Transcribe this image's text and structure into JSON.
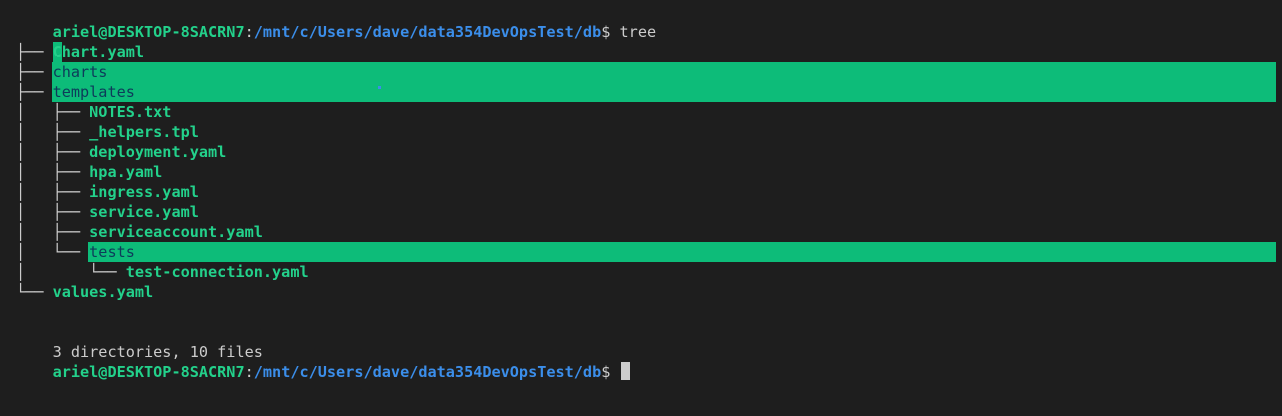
{
  "prompt": {
    "user_host": "ariel@DESKTOP-8SACRN7",
    "separator": ":",
    "path": "/mnt/c/Users/dave/data354DevOpsTest/db",
    "symbol": "$"
  },
  "command": " tree",
  "tree": {
    "root": ".",
    "entries": [
      {
        "branch": "├── ",
        "name": "Chart.yaml",
        "type": "file"
      },
      {
        "branch": "├── ",
        "name": "charts",
        "type": "dir"
      },
      {
        "branch": "├── ",
        "name": "templates",
        "type": "dir"
      },
      {
        "branch": "│   ├── ",
        "name": "NOTES.txt",
        "type": "file"
      },
      {
        "branch": "│   ├── ",
        "name": "_helpers.tpl",
        "type": "file"
      },
      {
        "branch": "│   ├── ",
        "name": "deployment.yaml",
        "type": "file"
      },
      {
        "branch": "│   ├── ",
        "name": "hpa.yaml",
        "type": "file"
      },
      {
        "branch": "│   ├── ",
        "name": "ingress.yaml",
        "type": "file"
      },
      {
        "branch": "│   ├── ",
        "name": "service.yaml",
        "type": "file"
      },
      {
        "branch": "│   ├── ",
        "name": "serviceaccount.yaml",
        "type": "file"
      },
      {
        "branch": "│   └── ",
        "name": "tests",
        "type": "dir"
      },
      {
        "branch": "│       └── ",
        "name": "test-connection.yaml",
        "type": "file"
      },
      {
        "branch": "└── ",
        "name": "values.yaml",
        "type": "file"
      }
    ]
  },
  "summary": "3 directories, 10 files",
  "colors": {
    "background": "#1e1e1e",
    "user_green": "#23d18b",
    "path_blue": "#3b8eea",
    "dir_highlight": "#0dbc79",
    "dir_text": "#0e3b5a"
  }
}
